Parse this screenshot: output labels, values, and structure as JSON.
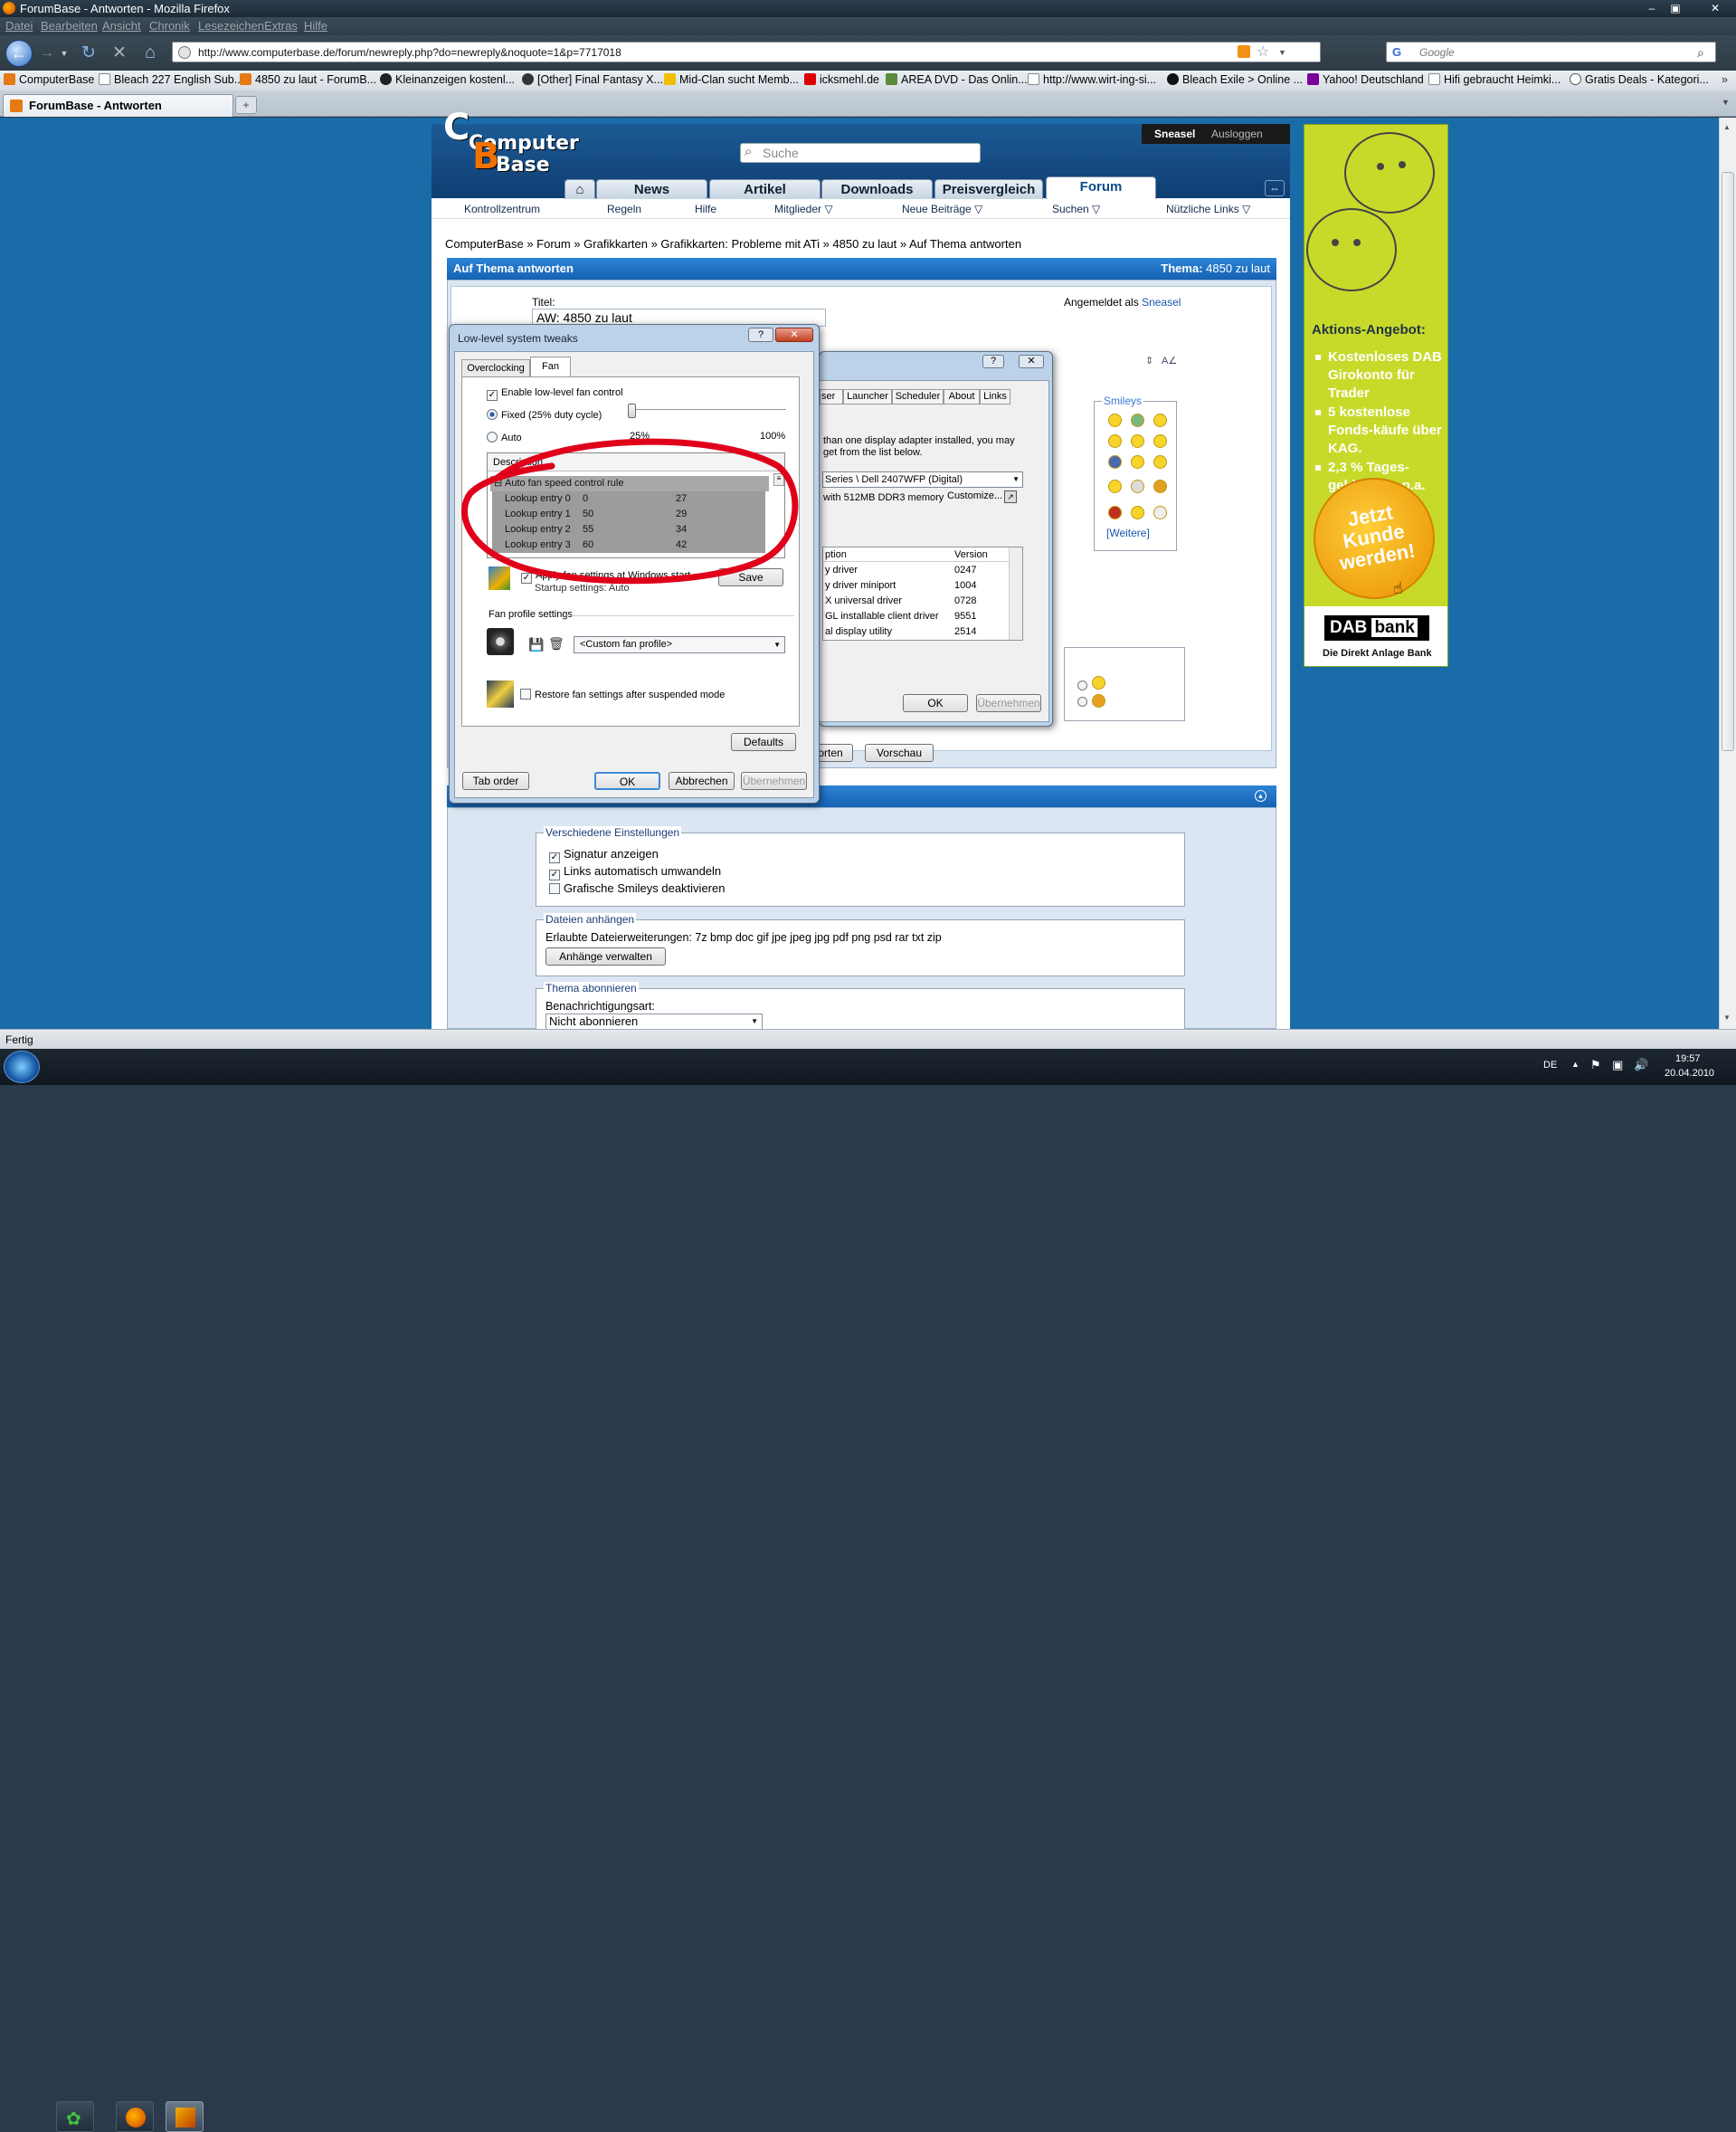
{
  "window": {
    "title": "ForumBase - Antworten - Mozilla Firefox"
  },
  "menubar": [
    "Datei",
    "Bearbeiten",
    "Ansicht",
    "Chronik",
    "Lesezeichen",
    "Extras",
    "Hilfe"
  ],
  "navbar": {
    "url": "http://www.computerbase.de/forum/newreply.php?do=newreply&noquote=1&p=7717018",
    "search_placeholder": "Google"
  },
  "bookmarks": [
    "ComputerBase",
    "Bleach 227 English Sub...",
    "4850 zu laut - ForumB...",
    "Kleinanzeigen kostenl...",
    "[Other] Final Fantasy X...",
    "Mid-Clan sucht Memb...",
    "icksmehl.de",
    "AREA DVD - Das Onlin...",
    "http://www.wirt-ing-si...",
    "Bleach Exile > Online ...",
    "Yahoo! Deutschland",
    "Hifi gebraucht Heimki...",
    "Gratis Deals - Kategori..."
  ],
  "tab": {
    "label": "ForumBase - Antworten"
  },
  "site": {
    "logo_line1": "Computer",
    "logo_line2": "Base",
    "search_placeholder": "Suche",
    "user": "Sneasel",
    "logout": "Ausloggen",
    "nav": [
      "News",
      "Artikel",
      "Downloads",
      "Preisvergleich",
      "Forum"
    ],
    "subnav": [
      "Kontrollzentrum",
      "Regeln",
      "Hilfe",
      "Mitglieder ▽",
      "Neue Beiträge ▽",
      "Suchen ▽",
      "Nützliche Links ▽"
    ],
    "breadcrumb": "ComputerBase » Forum » Grafikkarten » Grafikkarten: Probleme mit ATi » 4850 zu laut » Auf Thema antworten",
    "panel_title": "Auf Thema antworten",
    "thema_label": "Thema:",
    "thema_value": "4850 zu laut",
    "title_label": "Titel:",
    "title_value": "AW: 4850 zu laut",
    "logged_in_label": "Angemeldet als",
    "logged_in_user": "Sneasel",
    "smileys_label": "Smileys",
    "smileys_more": "[Weitere]",
    "btn_reply_partial": "orten",
    "btn_preview": "Vorschau",
    "settings_legend": "Verschiedene Einstellungen",
    "opt_signature": "Signatur anzeigen",
    "opt_links": "Links automatisch umwandeln",
    "opt_smileys": "Grafische Smileys deaktivieren",
    "attach_legend": "Dateien anhängen",
    "attach_ext": "Erlaubte Dateierweiterungen: 7z bmp doc gif jpe jpeg jpg pdf png psd rar txt zip",
    "attach_btn": "Anhänge verwalten",
    "subscribe_legend": "Thema abonnieren",
    "notify_label": "Benachrichtigungsart:",
    "notify_value": "Nicht abonnieren"
  },
  "ad": {
    "headline": "Aktions-Angebot:",
    "items": [
      "Kostenloses DAB Girokonto für Trader",
      "5 kostenlose Fonds-käufe über KAG.",
      "2,3 % Tages-geldzinsen p.a."
    ],
    "cta": "Jetzt Kunde werden!",
    "brand1": "DAB",
    "brand2": "bank",
    "tagline": "Die Direkt Anlage Bank"
  },
  "back_dialog": {
    "tabs": [
      "ser",
      "Launcher",
      "Scheduler",
      "About",
      "Links"
    ],
    "text": "than one display adapter installed, you may\nget from the list below.",
    "adapter": "Series  \\ Dell 2407WFP (Digital)",
    "memory": "with 512MB DDR3 memory",
    "customize": "Customize...",
    "col_option": "ption",
    "col_version": "Version",
    "rows": [
      [
        "y driver",
        "0247"
      ],
      [
        "y driver miniport",
        "1004"
      ],
      [
        "X universal driver",
        "0728"
      ],
      [
        "GL installable client driver",
        "9551"
      ],
      [
        "al display utility",
        "2514"
      ]
    ],
    "ok": "OK",
    "apply": "Übernehmen"
  },
  "dialog": {
    "title": "Low-level system tweaks",
    "tabs": [
      "Overclocking",
      "Fan"
    ],
    "enable": "Enable low-level fan control",
    "fixed": "Fixed (25% duty cycle)",
    "auto": "Auto",
    "pct_min": "25%",
    "pct_max": "100%",
    "slider_value": 0.25,
    "grid_head": "Description",
    "rule": "Auto fan speed control rule",
    "entries": [
      [
        "Lookup entry 0",
        "0",
        "27"
      ],
      [
        "Lookup entry 1",
        "50",
        "29"
      ],
      [
        "Lookup entry 2",
        "55",
        "34"
      ],
      [
        "Lookup entry 3",
        "60",
        "42"
      ]
    ],
    "apply_startup": "Apply fan settings at Windows start",
    "startup_settings": "Startup settings:  Auto",
    "save": "Save",
    "profile_legend": "Fan profile settings",
    "profile_value": "<Custom fan profile>",
    "restore": "Restore fan settings after suspended mode",
    "defaults": "Defaults",
    "tab_order": "Tab order",
    "ok": "OK",
    "cancel": "Abbrechen",
    "apply": "Übernehmen"
  },
  "status": {
    "text": "Fertig"
  },
  "tray": {
    "lang": "DE",
    "time": "19:57",
    "date": "20.04.2010"
  },
  "colors": {
    "annotation": "#e0001a",
    "header": "#0f3e72",
    "accent_orange": "#f07000"
  }
}
